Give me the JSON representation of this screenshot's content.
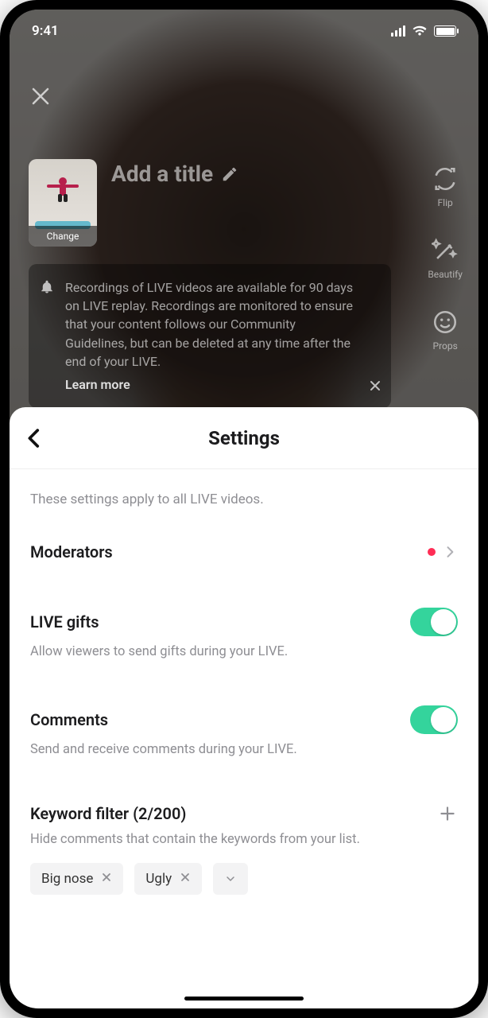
{
  "status": {
    "time": "9:41"
  },
  "golive": {
    "title_placeholder": "Add a title",
    "cover_change_label": "Change",
    "tools": {
      "flip": "Flip",
      "beautify": "Beautify",
      "props": "Props"
    },
    "banner_text": "Recordings of LIVE videos are available for 90 days on LIVE replay. Recordings are monitored to ensure that your content follows our Community Guidelines, but can be deleted at any time after the end of your LIVE.",
    "banner_learn_more": "Learn more"
  },
  "sheet": {
    "title": "Settings",
    "subtitle": "These settings apply to all LIVE videos.",
    "moderators": {
      "label": "Moderators"
    },
    "live_gifts": {
      "label": "LIVE gifts",
      "desc": "Allow viewers to send gifts during your LIVE.",
      "on": true
    },
    "comments": {
      "label": "Comments",
      "desc": "Send and receive comments during your LIVE.",
      "on": true
    },
    "keyword_filter": {
      "label": "Keyword filter (2/200)",
      "desc": "Hide comments that contain the keywords from your list.",
      "chips": [
        "Big nose",
        "Ugly"
      ]
    }
  }
}
